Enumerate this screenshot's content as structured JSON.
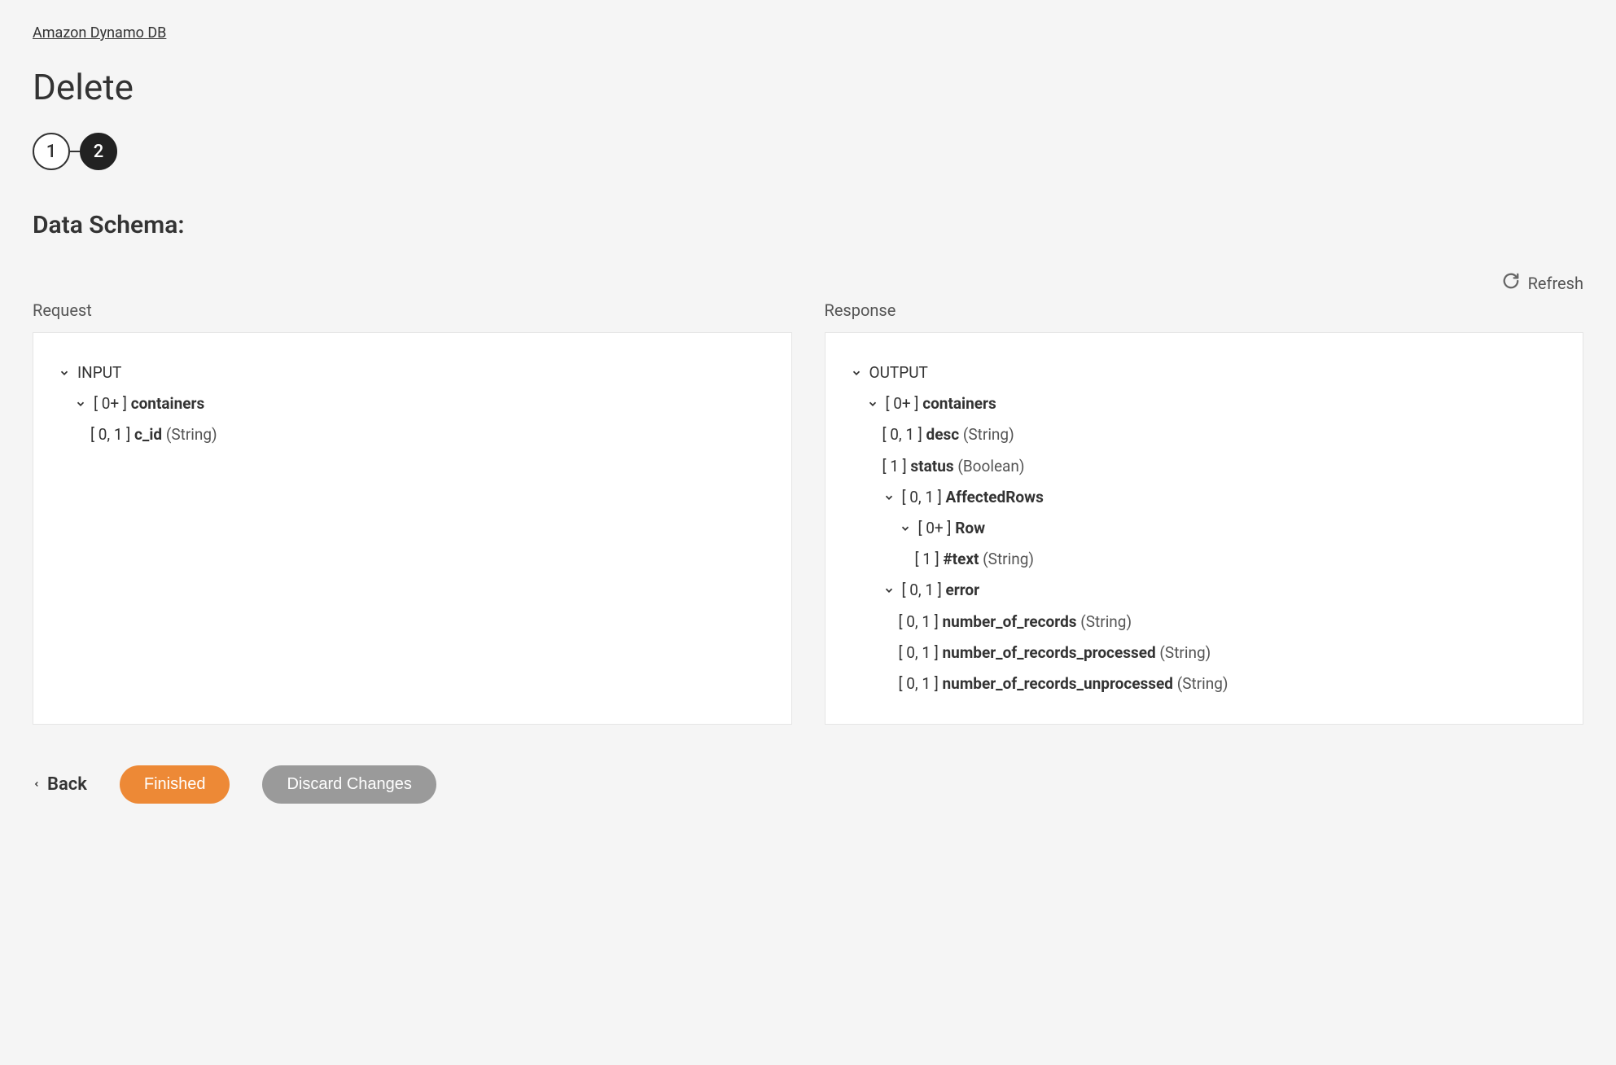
{
  "breadcrumb": "Amazon Dynamo DB",
  "page_title": "Delete",
  "stepper": {
    "step1": "1",
    "step2": "2"
  },
  "section_title": "Data Schema:",
  "refresh_label": "Refresh",
  "panels": {
    "request_label": "Request",
    "response_label": "Response"
  },
  "request_tree": {
    "root": "INPUT",
    "containers_card": "[ 0+ ]",
    "containers_name": "containers",
    "cid_card": "[ 0, 1 ]",
    "cid_name": "c_id",
    "cid_type": "(String)"
  },
  "response_tree": {
    "root": "OUTPUT",
    "containers_card": "[ 0+ ]",
    "containers_name": "containers",
    "desc_card": "[ 0, 1 ]",
    "desc_name": "desc",
    "desc_type": "(String)",
    "status_card": "[ 1 ]",
    "status_name": "status",
    "status_type": "(Boolean)",
    "affected_card": "[ 0, 1 ]",
    "affected_name": "AffectedRows",
    "row_card": "[ 0+ ]",
    "row_name": "Row",
    "text_card": "[ 1 ]",
    "text_name": "#text",
    "text_type": "(String)",
    "error_card": "[ 0, 1 ]",
    "error_name": "error",
    "num_records_card": "[ 0, 1 ]",
    "num_records_name": "number_of_records",
    "num_records_type": "(String)",
    "num_proc_card": "[ 0, 1 ]",
    "num_proc_name": "number_of_records_processed",
    "num_proc_type": "(String)",
    "num_unproc_card": "[ 0, 1 ]",
    "num_unproc_name": "number_of_records_unprocessed",
    "num_unproc_type": "(String)"
  },
  "footer": {
    "back": "Back",
    "finished": "Finished",
    "discard": "Discard Changes"
  }
}
